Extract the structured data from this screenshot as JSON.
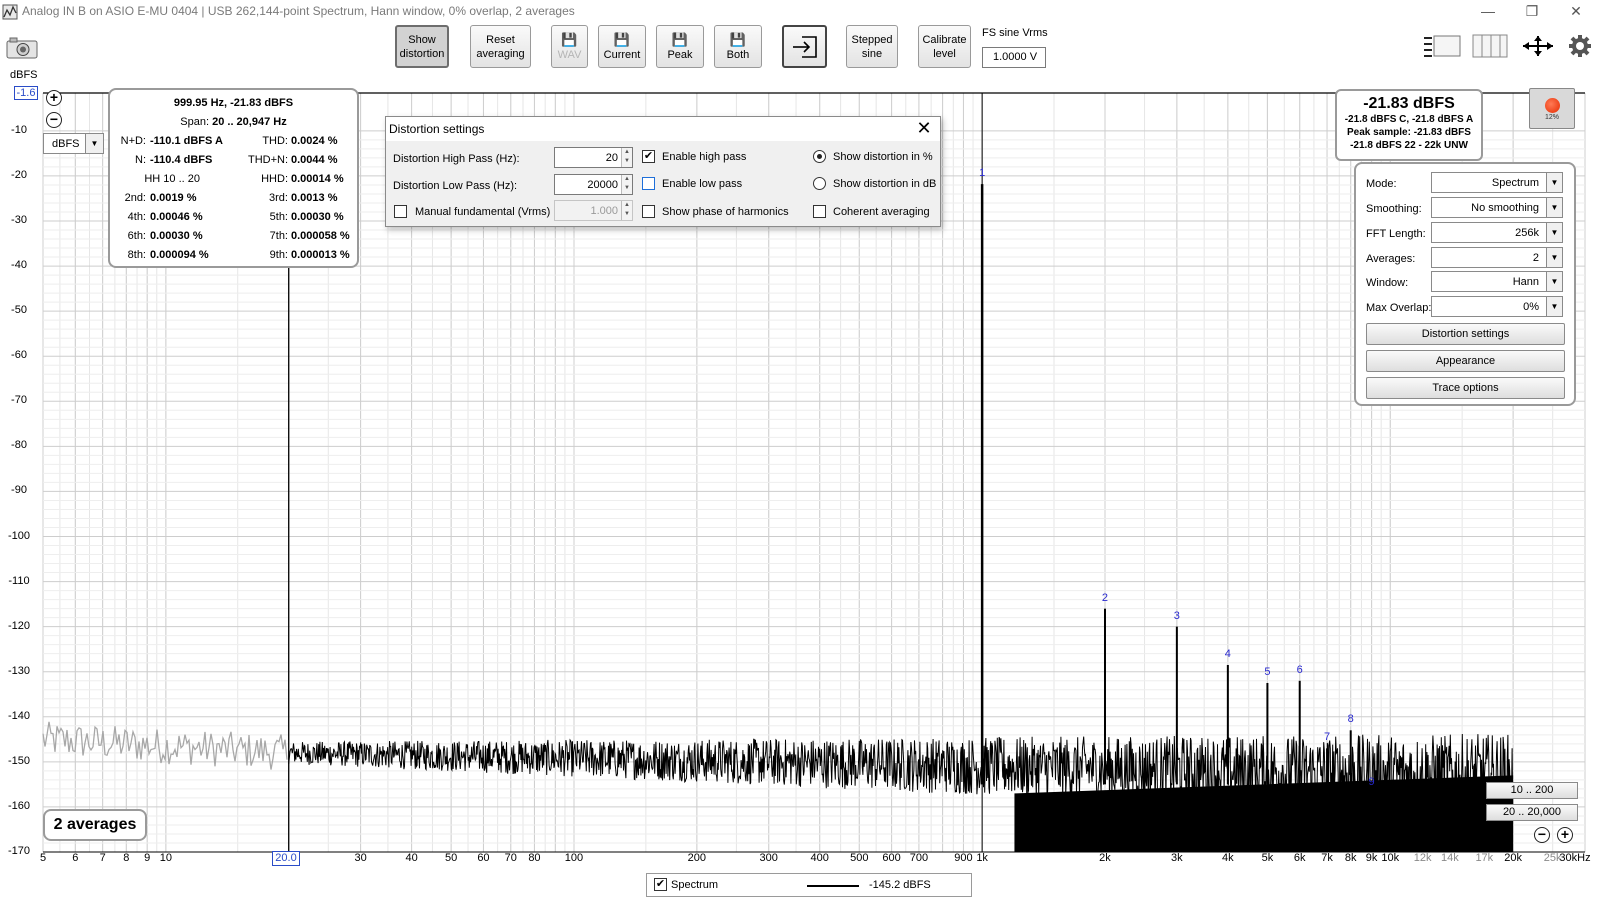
{
  "window": {
    "title": "Analog IN B on ASIO E-MU 0404 | USB 262,144-point Spectrum, Hann window, 0% overlap, 2 averages",
    "minimize": "—",
    "maximize": "❐",
    "close": "✕"
  },
  "toolbar": {
    "show_distortion": [
      "Show",
      "distortion"
    ],
    "reset_averaging": [
      "Reset",
      "averaging"
    ],
    "wav": "WAV",
    "current": "Current",
    "peak": "Peak",
    "both": "Both",
    "stepped_sine": [
      "Stepped",
      "sine"
    ],
    "calibrate_level": [
      "Calibrate",
      "level"
    ],
    "fs_sine_label": "FS sine Vrms",
    "fs_sine_value": "1.0000 V"
  },
  "plot": {
    "y_unit": "dBFS",
    "y_top_value": "-1.6",
    "unit_select": "dBFS",
    "y_ticks": [
      "-10",
      "-20",
      "-30",
      "-40",
      "-50",
      "-60",
      "-70",
      "-80",
      "-90",
      "-100",
      "-110",
      "-120",
      "-130",
      "-140",
      "-150",
      "-160",
      "-170"
    ],
    "x_ticks_major": [
      "5",
      "6",
      "7",
      "8",
      "9",
      "10",
      "30",
      "40",
      "50",
      "60",
      "70",
      "80",
      "100",
      "200",
      "300",
      "400",
      "500",
      "600",
      "700",
      "900",
      "1k",
      "2k",
      "3k",
      "4k",
      "5k",
      "6k",
      "7k",
      "8k",
      "9k",
      "10k",
      "20k",
      "30kHz"
    ],
    "x_ticks_minor": [
      "12k",
      "14k",
      "17k",
      "25k"
    ],
    "x_marker": "20.0",
    "harmonic_labels": [
      "1",
      "2",
      "3",
      "4",
      "5",
      "6",
      "7",
      "8",
      "9"
    ],
    "averages_badge": "2 averages",
    "range_btn_1": "10 .. 200",
    "range_btn_2": "20 .. 20,000"
  },
  "chart_data": {
    "type": "line",
    "title": "",
    "xlabel": "Hz",
    "ylabel": "dBFS",
    "x_scale": "log",
    "xlim": [
      5,
      30000
    ],
    "ylim": [
      -170,
      -1.6
    ],
    "grid": true,
    "series": [
      {
        "name": "Spectrum",
        "harmonic_peaks_hz": [
          1000,
          2000,
          3000,
          4000,
          5000,
          6000,
          7000,
          8000,
          9000
        ],
        "harmonic_peaks_dbfs": [
          -21.83,
          -116.0,
          -120.0,
          -128.5,
          -132.5,
          -132.0,
          -147.0,
          -143.0,
          -157.0
        ],
        "noise_floor_dbfs": -155,
        "low_freq_region_dbfs": -145
      }
    ]
  },
  "readout": {
    "header": "999.95 Hz, -21.83 dBFS",
    "span_label": "Span:",
    "span_value": "20 .. 20,947 Hz",
    "rows": [
      {
        "l1": "N+D:",
        "v1": "-110.1 dBFS A",
        "l2": "THD:",
        "v2": "0.0024 %"
      },
      {
        "l1": "N:",
        "v1": "-110.4 dBFS",
        "l2": "THD+N:",
        "v2": "0.0044 %"
      },
      {
        "l1": "HH 10 .. 20",
        "v1": "",
        "l2": "HHD:",
        "v2": "0.00014 %"
      },
      {
        "l1": "2nd:",
        "v1": "0.0019 %",
        "l2": "3rd:",
        "v2": "0.0013 %"
      },
      {
        "l1": "4th:",
        "v1": "0.00046 %",
        "l2": "5th:",
        "v2": "0.00030 %"
      },
      {
        "l1": "6th:",
        "v1": "0.00030 %",
        "l2": "7th:",
        "v2": "0.000058 %"
      },
      {
        "l1": "8th:",
        "v1": "0.000094 %",
        "l2": "9th:",
        "v2": "0.000013 %"
      }
    ]
  },
  "level": {
    "main": "-21.83 dBFS",
    "line1": "-21.8 dBFS C, -21.8 dBFS A",
    "line2": "Peak sample: -21.83 dBFS",
    "line3": "-21.8 dBFS 22 - 22k UNW",
    "rec_pct": "12%"
  },
  "settings": {
    "mode_label": "Mode:",
    "mode_value": "Spectrum",
    "smoothing_label": "Smoothing:",
    "smoothing_value": "No  smoothing",
    "fft_label": "FFT Length:",
    "fft_value": "256k",
    "averages_label": "Averages:",
    "averages_value": "2",
    "window_label": "Window:",
    "window_value": "Hann",
    "overlap_label": "Max Overlap:",
    "overlap_value": "0%",
    "btn_distortion": "Distortion settings",
    "btn_appearance": "Appearance",
    "btn_trace": "Trace options"
  },
  "dialog": {
    "title": "Distortion settings",
    "high_pass_label": "Distortion High Pass (Hz):",
    "high_pass_value": "20",
    "low_pass_label": "Distortion Low Pass (Hz):",
    "low_pass_value": "20000",
    "manual_fund_label": "Manual fundamental (Vrms)",
    "manual_fund_value": "1.000",
    "enable_high_pass": "Enable high pass",
    "enable_low_pass": "Enable low pass",
    "show_phase": "Show phase of harmonics",
    "show_pct": "Show distortion in %",
    "show_db": "Show distortion in dB",
    "coherent": "Coherent averaging"
  },
  "legend": {
    "name": "Spectrum",
    "value": "-145.2 dBFS"
  },
  "colors": {
    "trace": "#000000",
    "trace_low": "#a8a8a8",
    "grid": "#d8d8d8",
    "harmonic_label": "#2a2ad0",
    "marker": "#2a4cc8"
  }
}
